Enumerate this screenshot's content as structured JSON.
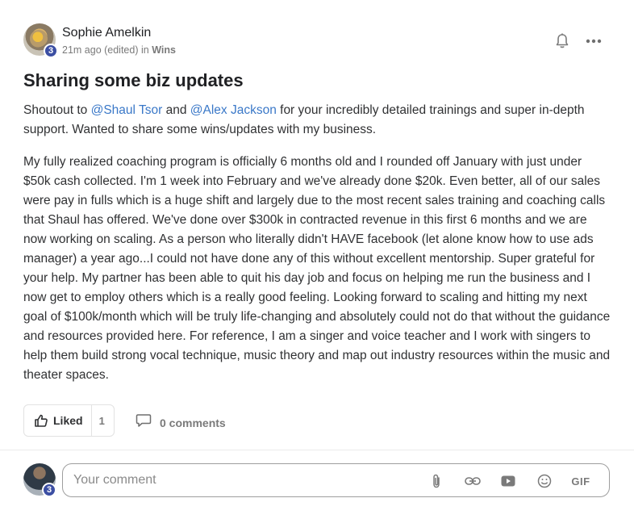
{
  "author": {
    "name": "Sophie Amelkin",
    "level": "3",
    "time": "21m ago (edited) in ",
    "category": "Wins"
  },
  "post": {
    "title": "Sharing some biz updates",
    "p1_a": "Shoutout to ",
    "mention1": "@Shaul Tsor",
    "p1_b": " and ",
    "mention2": "@Alex Jackson",
    "p1_c": " for your incredibly detailed trainings and super in-depth support. Wanted to share some wins/updates with my business.",
    "p2": "My fully realized coaching program is officially 6 months old and I rounded off January with just under $50k cash collected. I'm 1 week into February and we've already done $20k. Even better, all of our sales were pay in fulls which is a huge shift and largely due to the most recent sales training and coaching calls that Shaul has offered. We've done over $300k in contracted revenue in this first 6 months and we are now working on scaling. As a person who literally didn't HAVE facebook (let alone know how to use ads manager) a year ago...I could not have done any of this without excellent mentorship. Super grateful for your help. My partner has been able to quit his day job and focus on helping me run the business and I now get to employ others which is a really good feeling. Looking forward to scaling and hitting my next goal of $100k/month which will be truly life-changing and absolutely could not do that without the guidance and resources provided here. For reference, I am a singer and voice teacher and I work with singers to help them build strong vocal technique, music theory and map out industry resources within the music and theater spaces."
  },
  "actions": {
    "like_label": "Liked",
    "like_count": "1",
    "comments_label": "0 comments"
  },
  "composer": {
    "user_level": "3",
    "placeholder": "Your comment",
    "gif_label": "GIF"
  },
  "colors": {
    "mention": "#3a78c8",
    "badge": "#3c4fa3"
  }
}
